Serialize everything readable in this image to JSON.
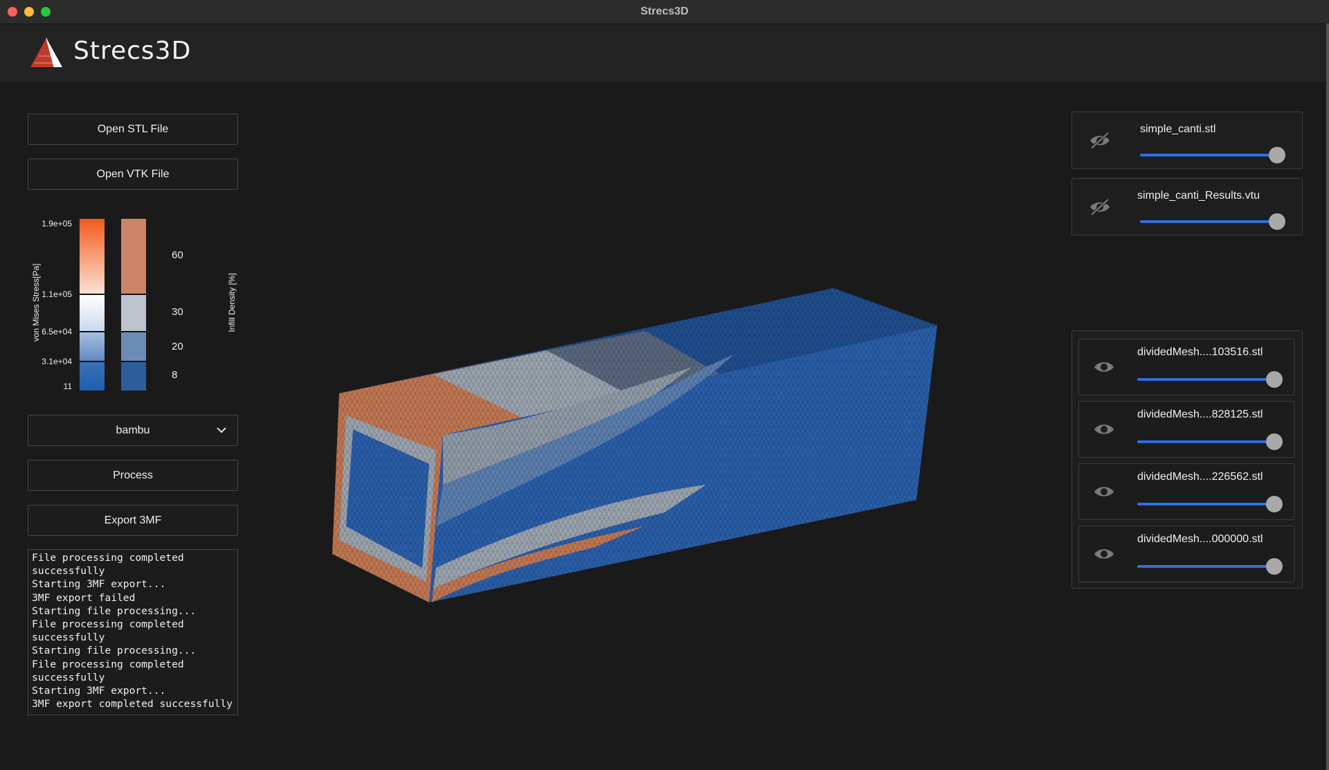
{
  "window": {
    "title": "Strecs3D"
  },
  "app": {
    "name": "Strecs3D"
  },
  "buttons": {
    "open_stl": "Open STL File",
    "open_vtk": "Open VTK File",
    "process": "Process",
    "export_3mf": "Export 3MF"
  },
  "printer_select": {
    "value": "bambu"
  },
  "legend": {
    "stress_label": "von Mises Stress[Pa]",
    "density_label": "Infill Density [%]",
    "stress_ticks": [
      "1.9e+05",
      "1.1e+05",
      "6.5e+04",
      "3.1e+04",
      "11"
    ],
    "density_ticks": [
      "60",
      "30",
      "20",
      "8"
    ],
    "colors": {
      "stress_high": "#f25a1c",
      "stress_mid": "#ffffff",
      "stress_low": "#1c5fb0",
      "density_60": "#cc8466",
      "density_30": "#bcc3cc",
      "density_20": "#6b8cb4",
      "density_8": "#2e5d9c"
    }
  },
  "console": {
    "lines": [
      "File processing completed",
      "successfully",
      "Starting 3MF export...",
      "3MF export failed",
      "Starting file processing...",
      "File processing completed",
      "successfully",
      "Starting file processing...",
      "File processing completed",
      "successfully",
      "Starting 3MF export...",
      "3MF export completed successfully"
    ]
  },
  "model_layers": [
    {
      "name": "simple_canti.stl",
      "icon": "eye-slash-icon",
      "opacity": 1.0
    },
    {
      "name": "simple_canti_Results.vtu",
      "icon": "eye-slash-icon",
      "opacity": 1.0
    }
  ],
  "mesh_layers": [
    {
      "name": "dividedMesh....103516.stl",
      "icon": "eye-icon",
      "opacity": 1.0
    },
    {
      "name": "dividedMesh....828125.stl",
      "icon": "eye-icon",
      "opacity": 1.0
    },
    {
      "name": "dividedMesh....226562.stl",
      "icon": "eye-icon",
      "opacity": 1.0
    },
    {
      "name": "dividedMesh....000000.stl",
      "icon": "eye-icon",
      "opacity": 1.0
    }
  ],
  "accent_color": "#2f6fe0"
}
